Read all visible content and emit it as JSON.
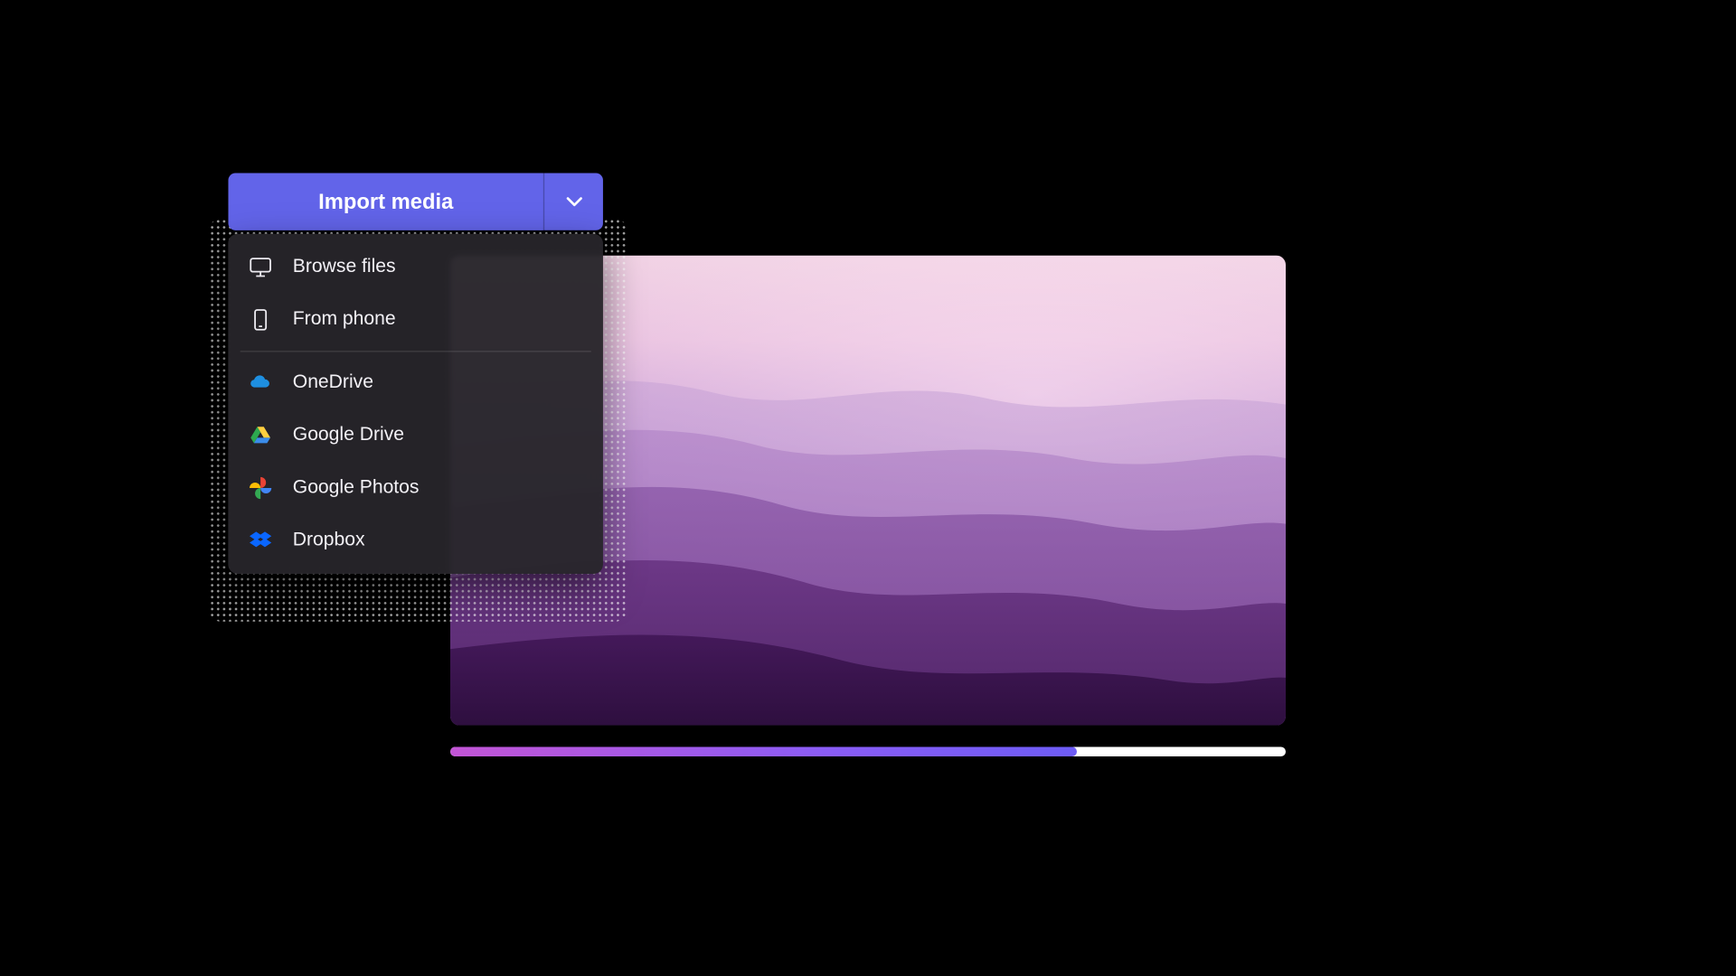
{
  "import": {
    "button_label": "Import media"
  },
  "menu": {
    "items": [
      {
        "label": "Browse files",
        "icon": "monitor-icon"
      },
      {
        "label": "From phone",
        "icon": "phone-icon"
      },
      {
        "label": "OneDrive",
        "icon": "onedrive-icon"
      },
      {
        "label": "Google Drive",
        "icon": "google-drive-icon"
      },
      {
        "label": "Google Photos",
        "icon": "google-photos-icon"
      },
      {
        "label": "Dropbox",
        "icon": "dropbox-icon"
      }
    ]
  },
  "progress": {
    "percent": 75
  },
  "colors": {
    "accent": "#6264E9",
    "progress_start": "#c355d6",
    "progress_end": "#6d5cf6"
  }
}
